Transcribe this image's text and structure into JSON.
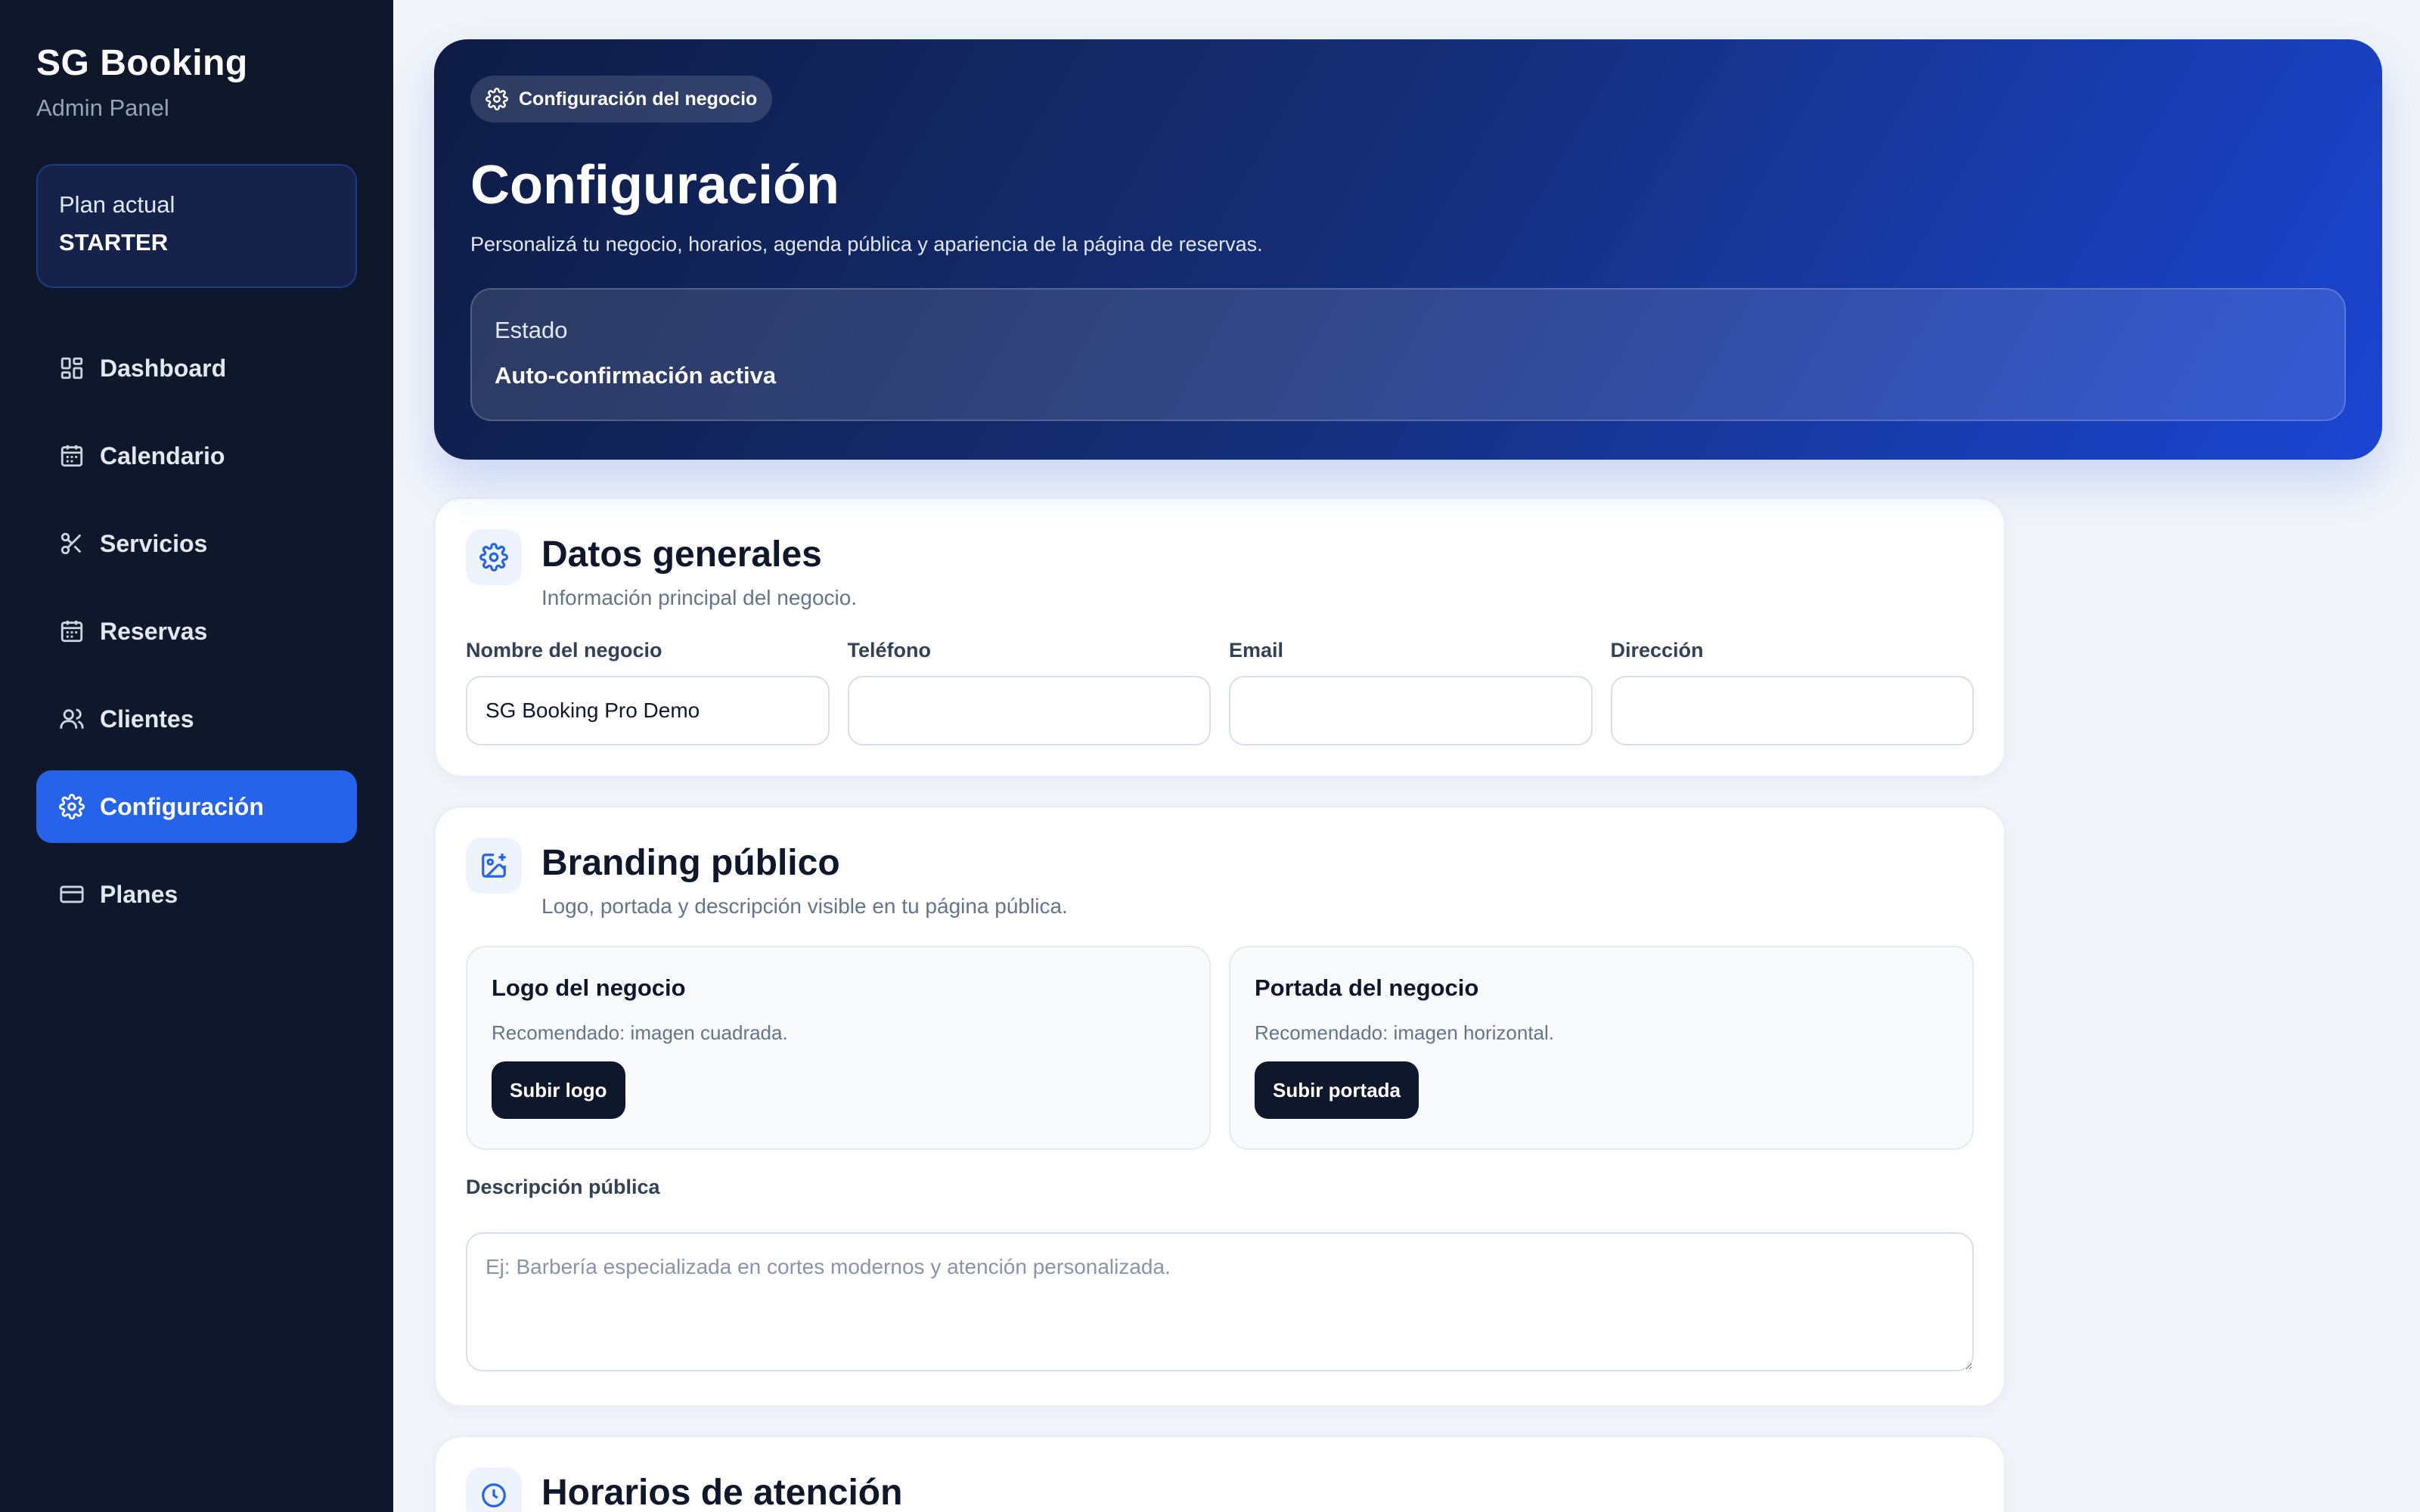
{
  "brand": {
    "title": "SG Booking",
    "subtitle": "Admin Panel"
  },
  "plan": {
    "label": "Plan actual",
    "value": "STARTER"
  },
  "nav": {
    "items": [
      {
        "label": "Dashboard",
        "icon": "dashboard-icon",
        "active": false
      },
      {
        "label": "Calendario",
        "icon": "calendar-icon",
        "active": false
      },
      {
        "label": "Servicios",
        "icon": "scissors-icon",
        "active": false
      },
      {
        "label": "Reservas",
        "icon": "calendar-icon",
        "active": false
      },
      {
        "label": "Clientes",
        "icon": "users-icon",
        "active": false
      },
      {
        "label": "Configuración",
        "icon": "gear-icon",
        "active": true
      },
      {
        "label": "Planes",
        "icon": "credit-card-icon",
        "active": false
      }
    ]
  },
  "hero": {
    "pill": "Configuración del negocio",
    "title": "Configuración",
    "description": "Personalizá tu negocio, horarios, agenda pública y apariencia de la página de reservas.",
    "status_label": "Estado",
    "status_value": "Auto-confirmación activa"
  },
  "general": {
    "title": "Datos generales",
    "subtitle": "Información principal del negocio.",
    "fields": [
      {
        "label": "Nombre del negocio",
        "value": "SG Booking Pro Demo"
      },
      {
        "label": "Teléfono",
        "value": ""
      },
      {
        "label": "Email",
        "value": ""
      },
      {
        "label": "Dirección",
        "value": ""
      }
    ]
  },
  "branding": {
    "title": "Branding público",
    "subtitle": "Logo, portada y descripción visible en tu página pública.",
    "logo": {
      "title": "Logo del negocio",
      "hint": "Recomendado: imagen cuadrada.",
      "button": "Subir logo"
    },
    "cover": {
      "title": "Portada del negocio",
      "hint": "Recomendado: imagen horizontal.",
      "button": "Subir portada"
    },
    "description_label": "Descripción pública",
    "description_placeholder": "Ej: Barbería especializada en cortes modernos y atención personalizada."
  },
  "hours": {
    "title": "Horarios de atención"
  },
  "colors": {
    "sidebar_bg": "#0f172a",
    "accent": "#2563eb",
    "page_bg": "#f1f4f9"
  }
}
